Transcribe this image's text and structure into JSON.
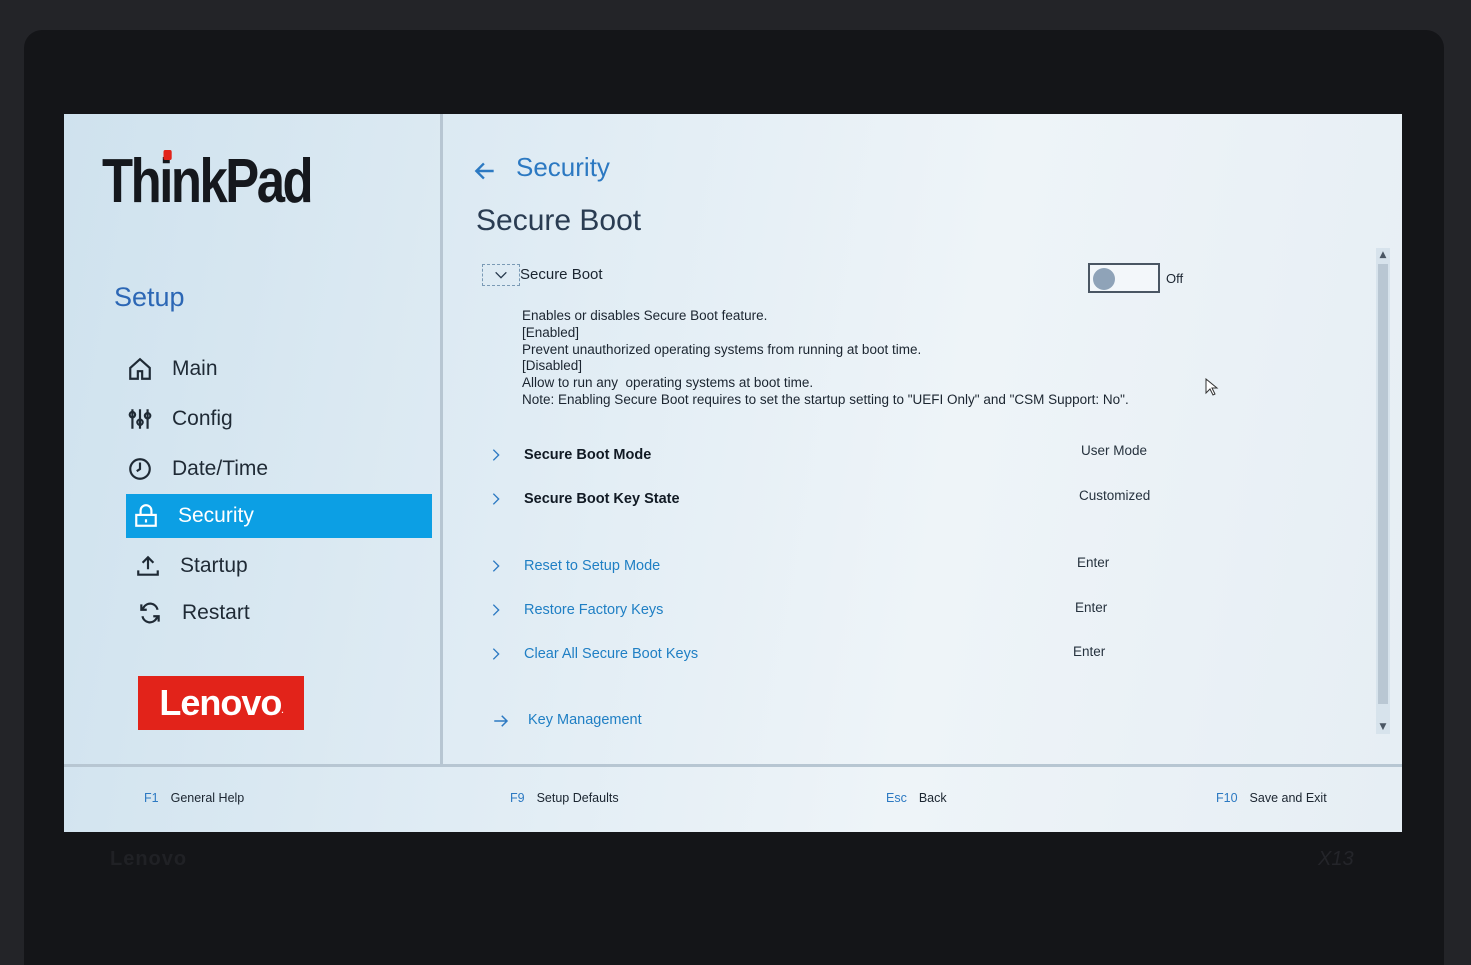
{
  "sidebar": {
    "logo": "ThinkPad",
    "title": "Setup",
    "items": [
      {
        "label": "Main",
        "icon": "home-icon"
      },
      {
        "label": "Config",
        "icon": "sliders-icon"
      },
      {
        "label": "Date/Time",
        "icon": "clock-icon"
      },
      {
        "label": "Security",
        "icon": "lock-icon",
        "active": true
      },
      {
        "label": "Startup",
        "icon": "upload-icon"
      },
      {
        "label": "Restart",
        "icon": "refresh-icon"
      }
    ],
    "brand": "Lenovo"
  },
  "header": {
    "breadcrumb": "Security",
    "title": "Secure Boot"
  },
  "secure_boot": {
    "label": "Secure Boot",
    "toggle_state": "Off",
    "description": [
      "Enables or disables Secure Boot feature.",
      "[Enabled]",
      "Prevent unauthorized operating systems from running at boot time.",
      "[Disabled]",
      "Allow to run any  operating systems at boot time.",
      "Note: Enabling Secure Boot requires to set the startup setting to \"UEFI Only\" and \"CSM Support: No\"."
    ]
  },
  "settings": [
    {
      "label": "Secure Boot Mode",
      "value": "User Mode"
    },
    {
      "label": "Secure Boot Key State",
      "value": "Customized"
    },
    {
      "label": "Reset to Setup Mode",
      "value": "Enter"
    },
    {
      "label": "Restore Factory Keys",
      "value": "Enter"
    },
    {
      "label": "Clear All Secure Boot Keys",
      "value": "Enter"
    },
    {
      "label": "Key Management"
    }
  ],
  "footer": [
    {
      "key": "F1",
      "label": "General Help"
    },
    {
      "key": "F9",
      "label": "Setup Defaults"
    },
    {
      "key": "Esc",
      "label": "Back"
    },
    {
      "key": "F10",
      "label": "Save and Exit"
    }
  ],
  "colors": {
    "accent": "#0c9fe4",
    "link": "#1f7fc4",
    "brand_red": "#e2231a"
  }
}
